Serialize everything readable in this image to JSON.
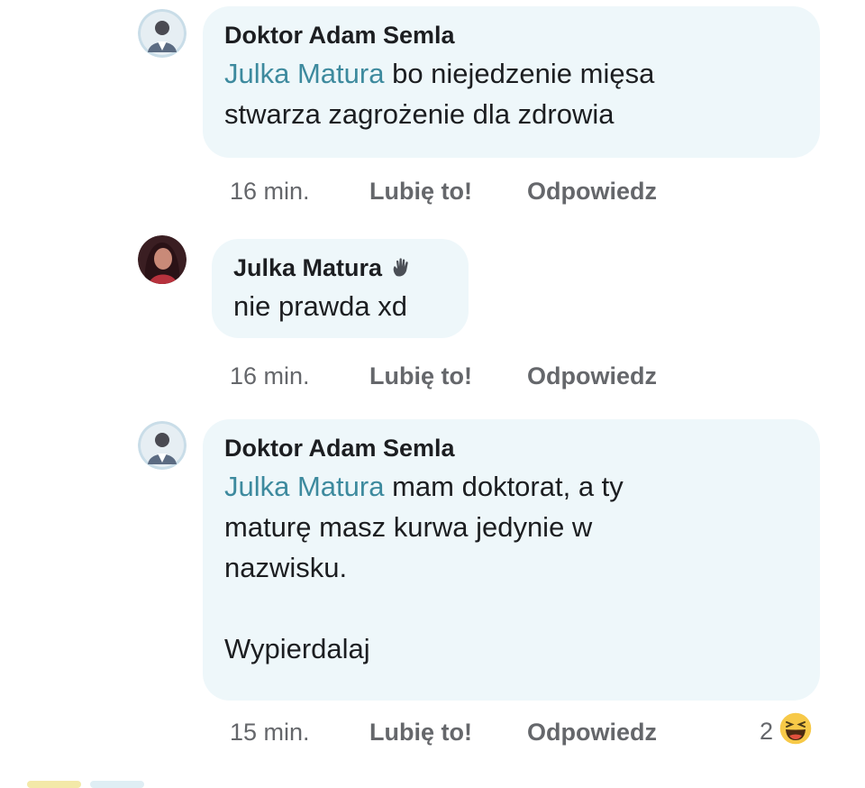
{
  "comments": [
    {
      "author": "Doktor Adam Semla",
      "mention": "Julka Matura",
      "lines": [
        " bo niejedzenie mięsa",
        "stwarza zagrożenie dla zdrowia"
      ],
      "time": "16 min.",
      "like": "Lubię to!",
      "reply": "Odpowiedz"
    },
    {
      "author": "Julka Matura",
      "badge_icon": "hand-wave-icon",
      "lines": [
        "nie prawda xd"
      ],
      "time": "16 min.",
      "like": "Lubię to!",
      "reply": "Odpowiedz"
    },
    {
      "author": "Doktor Adam Semla",
      "mention": "Julka Matura",
      "lines": [
        " mam doktorat, a ty",
        "maturę masz kurwa jedynie w",
        "nazwisku.",
        "",
        "Wypierdalaj"
      ],
      "time": "15 min.",
      "like": "Lubię to!",
      "reply": "Odpowiedz",
      "reaction_count": "2",
      "reaction_icon": "haha-emoji-icon"
    }
  ],
  "colors": {
    "bubble": "#eef7fa",
    "mention": "#3d8a9e",
    "meta": "#65676b",
    "text": "#1c1e21"
  }
}
